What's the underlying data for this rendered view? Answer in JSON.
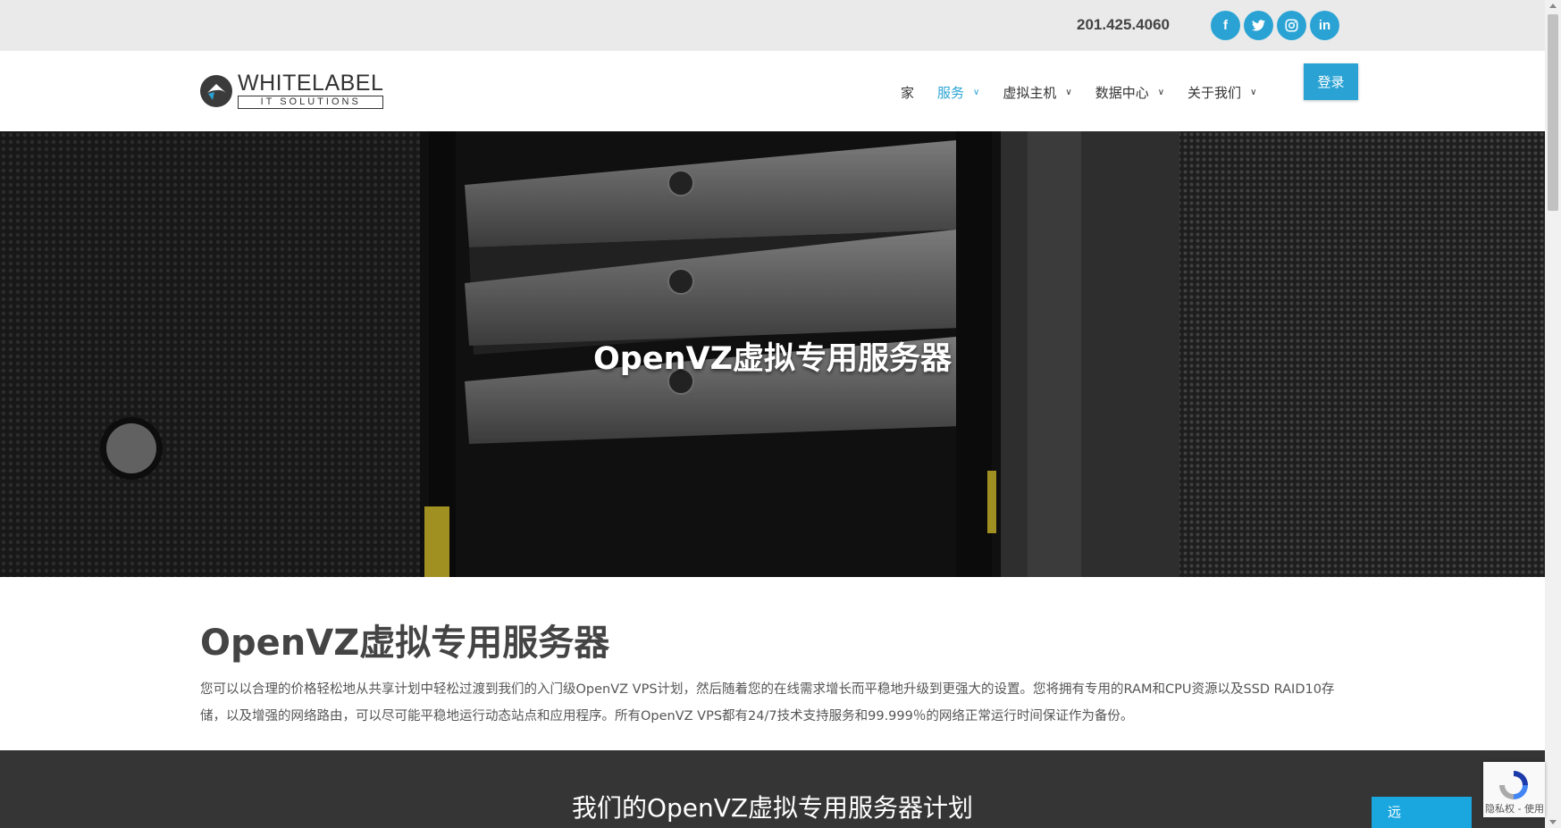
{
  "topbar": {
    "phone": "201.425.4060",
    "socials": [
      {
        "icon": "facebook-icon",
        "glyph": "f"
      },
      {
        "icon": "twitter-icon",
        "glyph": "t"
      },
      {
        "icon": "instagram-icon",
        "glyph": "◎"
      },
      {
        "icon": "linkedin-icon",
        "glyph": "in"
      }
    ]
  },
  "logo": {
    "line1": "WHITELABEL",
    "line2": "IT SOLUTIONS"
  },
  "nav": {
    "items": [
      {
        "label": "家"
      },
      {
        "label": "服务"
      },
      {
        "label": "虚拟主机"
      },
      {
        "label": "数据中心"
      },
      {
        "label": "关于我们"
      }
    ],
    "login": "登录"
  },
  "hero": {
    "title": "OpenVZ虚拟专用服务器"
  },
  "intro": {
    "heading": "OpenVZ虚拟专用服务器",
    "body": "您可以以合理的价格轻松地从共享计划中轻松过渡到我们的入门级OpenVZ VPS计划，然后随着您的在线需求增长而平稳地升级到更强大的设置。您将拥有专用的RAM和CPU资源以及SSD RAID10存储，以及增强的网络路由，可以尽可能平稳地运行动态站点和应用程序。所有OpenVZ VPS都有24/7技术支持服务和99.999％的网络正常运行时间保证作为备份。"
  },
  "plans": {
    "heading": "我们的OpenVZ虚拟专用服务器计划"
  },
  "widgets": {
    "recaptcha_text": "隐私权 - 使用",
    "chat_label": "远"
  },
  "colors": {
    "accent": "#2aa3d4",
    "dark_band": "#353535",
    "topbar": "#eaeaea"
  }
}
